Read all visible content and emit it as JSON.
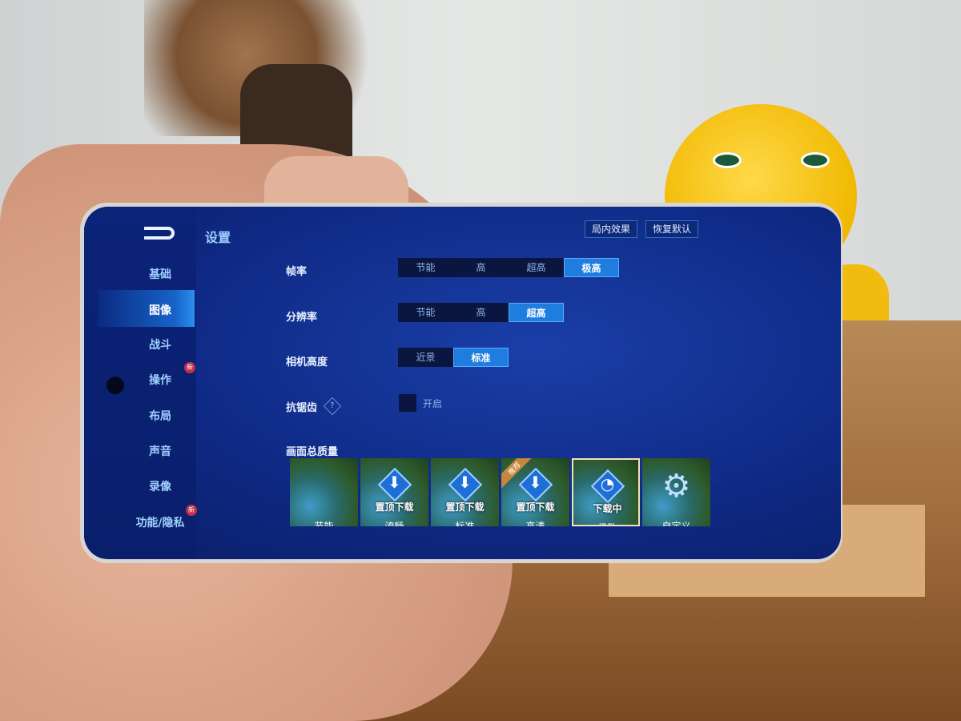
{
  "header": {
    "title": "设置",
    "back_icon": "back-arrow-icon"
  },
  "top_buttons": {
    "in_game_effect": "局内效果",
    "restore_default": "恢复默认"
  },
  "sidebar": {
    "items": [
      {
        "label": "基础"
      },
      {
        "label": "图像",
        "selected": true
      },
      {
        "label": "战斗"
      },
      {
        "label": "操作",
        "badge": "新"
      },
      {
        "label": "布局"
      },
      {
        "label": "声音"
      },
      {
        "label": "录像"
      },
      {
        "label": "功能/隐私",
        "badge": "新"
      }
    ]
  },
  "settings": {
    "frame_rate": {
      "label": "帧率",
      "options": [
        "节能",
        "高",
        "超高",
        "极高"
      ],
      "selected": "极高"
    },
    "resolution": {
      "label": "分辨率",
      "options": [
        "节能",
        "高",
        "超高"
      ],
      "selected": "超高"
    },
    "camera_height": {
      "label": "相机高度",
      "options": [
        "近景",
        "标准"
      ],
      "selected": "标准"
    },
    "anti_aliasing": {
      "label": "抗锯齿",
      "help_icon": "question-icon",
      "checkbox_label": "开启",
      "checked": false
    },
    "overall_quality": {
      "label": "画面总质量",
      "tiles": [
        {
          "name": "节能",
          "overlay": ""
        },
        {
          "name": "流畅",
          "overlay": "置顶下载"
        },
        {
          "name": "标准",
          "overlay": "置顶下载"
        },
        {
          "name": "高清",
          "overlay": "置顶下载",
          "tag": "推荐"
        },
        {
          "name": "极致",
          "overlay": "下载中",
          "selected": true
        },
        {
          "name": "自定义",
          "overlay": ""
        }
      ]
    }
  },
  "colors": {
    "accent": "#1f7de0",
    "screen_bg": "#0f2a86",
    "badge": "#c0304a"
  }
}
